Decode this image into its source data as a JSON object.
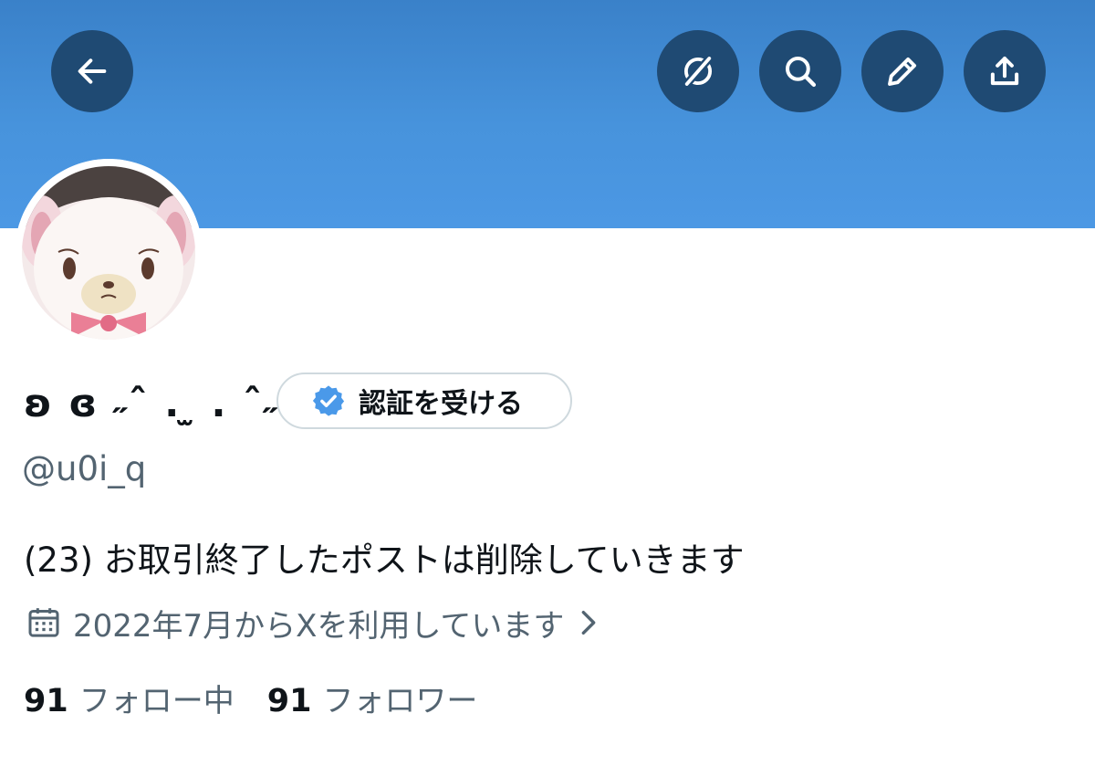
{
  "header": {
    "back_icon": "arrow-left-icon",
    "translate_icon": "slashed-globe-icon",
    "search_icon": "search-icon",
    "edit_icon": "pencil-icon",
    "share_icon": "share-upload-icon",
    "banner_color": "#4793dc",
    "button_color": "#1f4a73"
  },
  "profile": {
    "avatar_icon": "bear-avatar",
    "display_name": "ʚ ɞ ˶ˆ . ̫ . ˆ˶ ʚ ɞ",
    "verify_label": "認証を受ける",
    "verify_icon": "verified-badge-icon",
    "verify_color": "#4a99e9",
    "handle": "@u0i_q",
    "bio": "(23) お取引終了したポストは削除していきます",
    "joined_icon": "calendar-icon",
    "joined": "2022年7月からXを利用しています",
    "joined_chevron": "chevron-right-icon"
  },
  "stats": {
    "following_count": "91",
    "following_label": "フォロー中",
    "followers_count": "91",
    "followers_label": "フォロワー"
  }
}
